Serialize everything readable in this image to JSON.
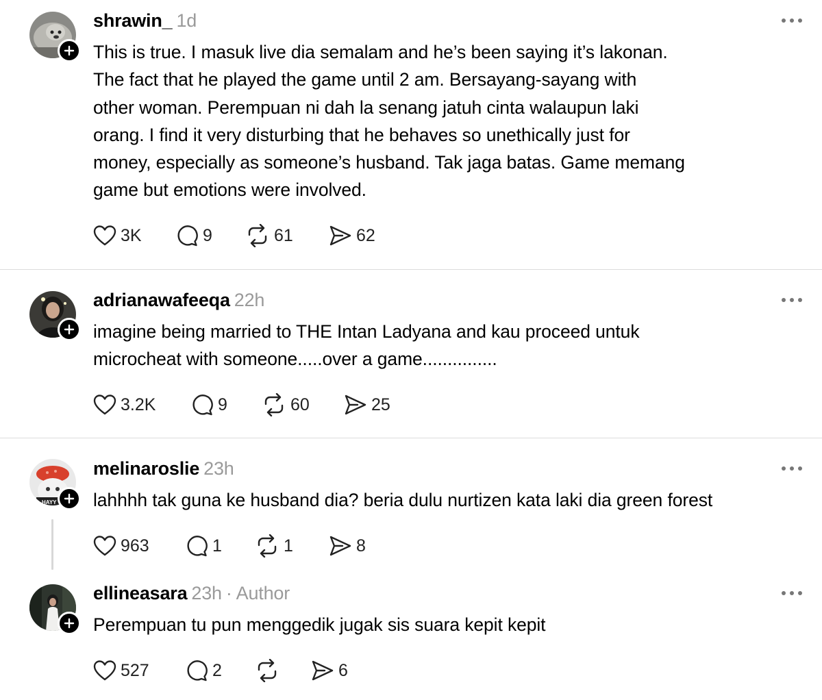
{
  "posts": [
    {
      "username": "shrawin_",
      "time": "1d",
      "lines": [
        "This is true. I masuk live dia semalam and he’s been saying it’s lakonan.",
        "The fact that he played the game until 2 am. Bersayang-sayang with",
        "other woman. Perempuan ni dah la senang jatuh cinta walaupun laki",
        "orang. I find it very disturbing that he behaves so unethically just for",
        "money, especially as someone’s husband. Tak jaga batas. Game memang",
        "game but emotions were involved."
      ],
      "likes": "3K",
      "replies": "9",
      "reposts": "61",
      "shares": "62"
    },
    {
      "username": "adrianawafeeqa",
      "time": "22h",
      "lines": [
        "imagine being married to THE Intan Ladyana and kau proceed untuk",
        "microcheat with someone.....over a game..............."
      ],
      "likes": "3.2K",
      "replies": "9",
      "reposts": "60",
      "shares": "25"
    },
    {
      "username": "melinaroslie",
      "time": "23h",
      "avatar_caption": "HAYY",
      "lines": [
        "lahhhh tak guna ke husband dia? beria dulu nurtizen kata laki dia green forest"
      ],
      "likes": "963",
      "replies": "1",
      "reposts": "1",
      "shares": "8"
    },
    {
      "username": "ellineasara",
      "time": "23h",
      "author_sep": "·",
      "author_tag": "Author",
      "lines": [
        "Perempuan tu pun menggedik jugak sis suara kepit kepit"
      ],
      "likes": "527",
      "replies": "2",
      "reposts": "",
      "shares": "6"
    }
  ],
  "icons": {
    "like": "heart-icon",
    "reply": "speech-bubble-icon",
    "repost": "repost-icon",
    "share": "send-icon",
    "more": "more-dots-icon",
    "follow": "plus-icon"
  }
}
